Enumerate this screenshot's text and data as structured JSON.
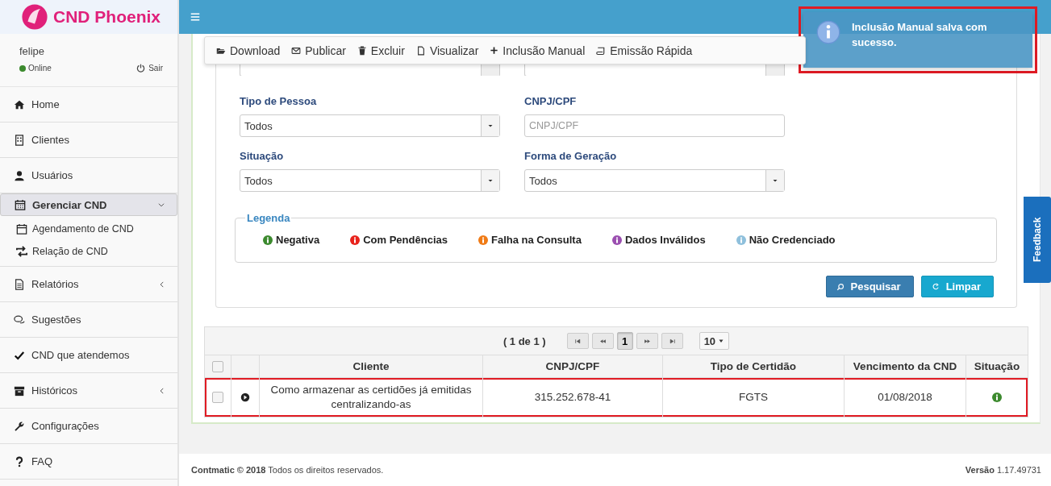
{
  "sidebar": {
    "brand": "CND Phoenix",
    "user": {
      "name": "felipe",
      "status": "Online",
      "logout": "Sair"
    },
    "items": [
      {
        "label": "Home",
        "kind": "link",
        "selected": false
      },
      {
        "label": "Clientes",
        "kind": "link",
        "selected": false
      },
      {
        "label": "Usuários",
        "kind": "link",
        "selected": false
      },
      {
        "label": "Gerenciar CND",
        "kind": "group",
        "selected": true,
        "expanded": true,
        "children": [
          {
            "label": "Agendamento de CND"
          },
          {
            "label": "Relação de CND"
          }
        ]
      },
      {
        "label": "Relatórios",
        "kind": "group",
        "selected": false,
        "expanded": false
      },
      {
        "label": "Sugestões",
        "kind": "link",
        "selected": false
      },
      {
        "label": "CND que atendemos",
        "kind": "link",
        "selected": false
      },
      {
        "label": "Históricos",
        "kind": "group",
        "selected": false,
        "expanded": false
      },
      {
        "label": "Configurações",
        "kind": "link",
        "selected": false
      },
      {
        "label": "FAQ",
        "kind": "link",
        "selected": false
      }
    ]
  },
  "toolbar": [
    "Download",
    "Publicar",
    "Excluir",
    "Visualizar",
    "Inclusão Manual",
    "Emissão Rápida"
  ],
  "filters": [
    {
      "label": "Tipo de Pessoa",
      "kind": "select",
      "value": "Todos"
    },
    {
      "label": "CNPJ/CPF",
      "kind": "input",
      "placeholder": "CNPJ/CPF"
    },
    {
      "label": "Situação",
      "kind": "select",
      "value": "Todos"
    },
    {
      "label": "Forma de Geração",
      "kind": "select",
      "value": "Todos"
    }
  ],
  "legend": {
    "title": "Legenda",
    "items": [
      {
        "label": "Negativa",
        "color": "#3c8a2e"
      },
      {
        "label": "Com Pendências",
        "color": "#e8231c"
      },
      {
        "label": "Falha na Consulta",
        "color": "#f07b16"
      },
      {
        "label": "Dados Inválidos",
        "color": "#9b4fb0"
      },
      {
        "label": "Não Credenciado",
        "color": "#8fc0dc"
      }
    ]
  },
  "buttons": [
    {
      "label": "Pesquisar",
      "kind": "primary"
    },
    {
      "label": "Limpar",
      "kind": "info"
    }
  ],
  "pager": {
    "summary": "( 1 de 1 )",
    "pages": [
      {
        "label": "1",
        "selected": true
      }
    ],
    "page_size": "10"
  },
  "table": {
    "columns": [
      "Cliente",
      "CNPJ/CPF",
      "Tipo de Certidão",
      "Vencimento da CND",
      "Situação"
    ],
    "all_checked": false,
    "rows": [
      {
        "checked": false,
        "highlighted": true,
        "cliente": "Como armazenar as certidões já emitidas centralizando-as",
        "cnpj": "315.252.678-41",
        "tipo": "FGTS",
        "vencimento": "01/08/2018",
        "color": "#3c8a2e"
      }
    ]
  },
  "footer": {
    "copyright": "**Contmatic © 2018** Todos os direitos reservados.",
    "version": "**Versão** 1.17.49731"
  },
  "notification": {
    "message": "Inclusão Manual salva com sucesso.",
    "highlighted": true
  },
  "feedback": "Feedback"
}
